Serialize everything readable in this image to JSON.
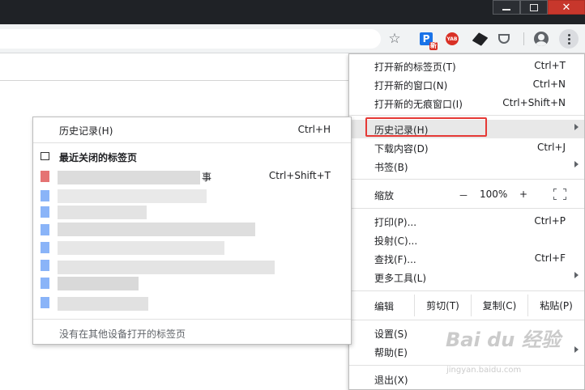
{
  "toolbar": {
    "ext_p_label": "P",
    "ext_p_badge": "新",
    "ext_yab_label": "YAB"
  },
  "menu": {
    "new_tab": {
      "label": "打开新的标签页(T)",
      "shortcut": "Ctrl+T"
    },
    "new_window": {
      "label": "打开新的窗口(N)",
      "shortcut": "Ctrl+N"
    },
    "new_incognito": {
      "label": "打开新的无痕窗口(I)",
      "shortcut": "Ctrl+Shift+N"
    },
    "history": {
      "label": "历史记录(H)"
    },
    "downloads": {
      "label": "下载内容(D)",
      "shortcut": "Ctrl+J"
    },
    "bookmarks": {
      "label": "书签(B)"
    },
    "zoom": {
      "label": "缩放",
      "minus": "－",
      "value": "100%",
      "plus": "+"
    },
    "print": {
      "label": "打印(P)...",
      "shortcut": "Ctrl+P"
    },
    "cast": {
      "label": "投射(C)..."
    },
    "find": {
      "label": "查找(F)...",
      "shortcut": "Ctrl+F"
    },
    "more_tools": {
      "label": "更多工具(L)"
    },
    "edit": {
      "label": "编辑",
      "cut": "剪切(T)",
      "copy": "复制(C)",
      "paste": "粘贴(P)"
    },
    "settings": {
      "label": "设置(S)"
    },
    "help": {
      "label": "帮助(E)"
    },
    "exit": {
      "label": "退出(X)"
    }
  },
  "history_submenu": {
    "title": "历史记录(H)",
    "shortcut": "Ctrl+H",
    "recently_closed": "最近关闭的标签页",
    "first_row_end": "事",
    "first_row_shortcut": "Ctrl+Shift+T",
    "footer": "没有在其他设备打开的标签页"
  },
  "watermark": {
    "main": "Bai du 经验",
    "sub": "jingyan.baidu.com"
  },
  "colors": {
    "highlight_box": "#e53935",
    "title_bar": "#1f2226",
    "toolbar": "#f1f3f4",
    "blue_favicon": "#8ab4f8",
    "red_favicon": "#e57373"
  }
}
